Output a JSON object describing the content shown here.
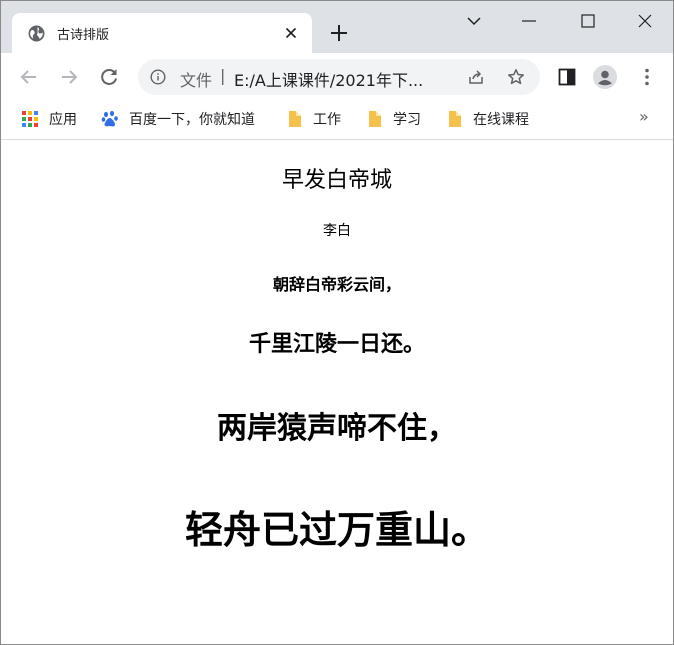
{
  "browser": {
    "tab": {
      "title": "古诗排版"
    },
    "omnibox": {
      "scheme_label": "文件",
      "separator": "|",
      "url": "E:/A上课课件/2021年下..."
    },
    "bookmarks": {
      "items": [
        {
          "label": "应用"
        },
        {
          "label": "百度一下，你就知道"
        },
        {
          "label": "工作"
        },
        {
          "label": "学习"
        },
        {
          "label": "在线课程"
        }
      ],
      "more": "»"
    },
    "colors": {
      "tabstrip": "#dee1e6",
      "omnibox": "#f1f3f4",
      "folder": "#f5c04b",
      "baidu": "#2f6ee6"
    }
  },
  "poem": {
    "title": "早发白帝城",
    "author": "李白",
    "lines": [
      "朝辞白帝彩云间，",
      "千里江陵一日还。",
      "两岸猿声啼不住，",
      "轻舟已过万重山。"
    ]
  }
}
